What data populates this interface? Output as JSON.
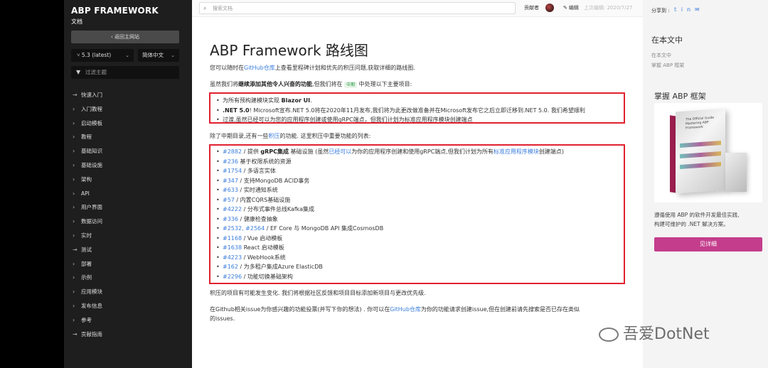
{
  "sidebar": {
    "brand": "ABP FRAMEWORK",
    "brand_sub": "文档",
    "back_label": "返回主网站",
    "version": "5.3 (latest)",
    "language": "简体中文",
    "filter_placeholder": "过滤主题",
    "items": [
      {
        "icon": "arrow",
        "label": "快速入门"
      },
      {
        "icon": "chevron",
        "label": "入门教程"
      },
      {
        "icon": "chevron",
        "label": "启动模板"
      },
      {
        "icon": "chevron",
        "label": "教程"
      },
      {
        "icon": "chevron",
        "label": "基础知识"
      },
      {
        "icon": "chevron",
        "label": "基础设施"
      },
      {
        "icon": "chevron",
        "label": "架构"
      },
      {
        "icon": "chevron",
        "label": "API"
      },
      {
        "icon": "chevron",
        "label": "用户界面"
      },
      {
        "icon": "chevron",
        "label": "数据访问"
      },
      {
        "icon": "chevron",
        "label": "实时"
      },
      {
        "icon": "arrow",
        "label": "测试"
      },
      {
        "icon": "chevron",
        "label": "部署"
      },
      {
        "icon": "chevron",
        "label": "示例"
      },
      {
        "icon": "chevron",
        "label": "应用模块"
      },
      {
        "icon": "chevron",
        "label": "发布信息"
      },
      {
        "icon": "chevron",
        "label": "参考"
      },
      {
        "icon": "arrow",
        "label": "贡献指南"
      }
    ]
  },
  "topbar": {
    "search_placeholder": "搜索文档",
    "contributors": "贡献者",
    "edit": "编辑",
    "last_edit": "上次编辑: 2020/7/27"
  },
  "main": {
    "title": "ABP Framework 路线图",
    "intro_a": "您可以随时在",
    "intro_link": "GitHub仓库",
    "intro_b": "上查看里程碑计划和优先的积压问题,获取详细的路线图.",
    "focus_a": "虽然我们将",
    "focus_bold": "继续添加其他令人兴奋的功能",
    "focus_b": ",但我们将在",
    "focus_tag": "中期",
    "focus_c": "中处理以下主要项目:",
    "major_1_a": "为所有预构建模块实现 ",
    "major_1_bold": "Blazor UI",
    "major_1_b": ".",
    "major_2_bold": ".NET 5.0",
    "major_2_a": "! Microsoft宣布.NET 5.0将在2020年11月发布,我们将为此更改做准备并在Microsoft发布它之后立即迁移到.NET 5.0. 我们希望顺利",
    "major_2_b": "过渡,虽然已经可以为您的应用程序创建或使用gRPC端点，但我们计划为标准应用程序模块创建端点",
    "backlog_a": "除了中期目录,还有一些",
    "backlog_link": "积压",
    "backlog_b": "的功能. 这里积压中重要功能的列表:",
    "features": [
      {
        "link": "#2882",
        "text": " / 提供 ",
        "bold": "gRPC集成",
        "rest_a": " 基础设施 (虽然",
        "link2": "已经可以",
        "rest_b": "为你的应用程序创建和使用gRPC端点,但我们计划为所有",
        "link3": "标准应用程序模块",
        "rest_c": "创建端点)"
      },
      {
        "link": "#236",
        "text": " 基于权限系统的资源"
      },
      {
        "link": "#1754",
        "text": " / 多语言实体"
      },
      {
        "link": "#347",
        "text": " / 支持MongoDB ACID事务"
      },
      {
        "link": "#633",
        "text": " / 实时通知系统"
      },
      {
        "link": "#57",
        "text": " / 内置CQRS基础设施"
      },
      {
        "link": "#4222",
        "text": " / 分布式事件总线Kafka集成"
      },
      {
        "link": "#336",
        "text": " / 健康检查抽象"
      },
      {
        "link": "#2532, #2564",
        "text": " / EF Core 与 MongoDB API 集成CosmosDB"
      },
      {
        "link": "#1168",
        "text": " / Vue 启动模板"
      },
      {
        "link": "#1638",
        "text": " React 启动模板"
      },
      {
        "link": "#4223",
        "text": " / WebHook系统"
      },
      {
        "link": "#162",
        "text": " / 为多租户集成Azure ElasticDB"
      },
      {
        "link": "#2296",
        "text": " / 功能切换基础架构"
      }
    ],
    "note": "积压的项目有可能发生变化. 我们将根据社区反馈和项目目标添加新项目与更改优先级.",
    "vote_a": "在Github相关issue为你感兴趣的功能投票(并写下你的想法) . 你可以在",
    "vote_link": "GitHub仓库",
    "vote_b": "为你的功能请求创建issue,但在创建前请先搜索是否已存在类似",
    "vote_c": "的issues."
  },
  "right": {
    "share_label": "分享到 :",
    "share_icons": [
      "twitter-icon",
      "linkedin-icon",
      "email-icon"
    ],
    "toc_title": "在本文中",
    "toc_items": [
      "在本文中",
      "掌握 ABP 框架"
    ],
    "ad_title": "掌握 ABP 框架",
    "book_text": "The Official Guide Mastering ABP Framework",
    "ad_desc_1": "遵循使用 ABP 的软件开发最佳实践,",
    "ad_desc_2": "构建可维护的 .NET 解决方案。",
    "detail_button": "见详细"
  },
  "watermark": "吾爱DotNet",
  "colors": {
    "highlight_box": "#e0212f",
    "link": "#3b7ddd",
    "button": "#c43d8c"
  }
}
